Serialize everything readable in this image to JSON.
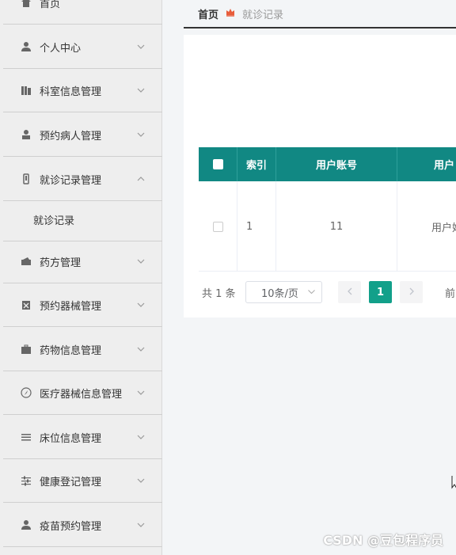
{
  "sidebar": {
    "home_label": "首页",
    "items": [
      {
        "label": "个人中心",
        "icon": "user-icon",
        "expanded": false
      },
      {
        "label": "科室信息管理",
        "icon": "building-icon",
        "expanded": false
      },
      {
        "label": "预约病人管理",
        "icon": "patient-icon",
        "expanded": false
      },
      {
        "label": "就诊记录管理",
        "icon": "phone-icon",
        "expanded": true
      },
      {
        "label": "药方管理",
        "icon": "wallet-icon",
        "expanded": false
      },
      {
        "label": "预约器械管理",
        "icon": "clipboard-icon",
        "expanded": false
      },
      {
        "label": "药物信息管理",
        "icon": "briefcase-icon",
        "expanded": false
      },
      {
        "label": "医疗器械信息管理",
        "icon": "compass-icon",
        "expanded": false
      },
      {
        "label": "床位信息管理",
        "icon": "list-icon",
        "expanded": false
      },
      {
        "label": "健康登记管理",
        "icon": "sliders-icon",
        "expanded": false
      },
      {
        "label": "疫苗预约管理",
        "icon": "person-icon",
        "expanded": false
      }
    ],
    "submenu": {
      "label": "就诊记录"
    }
  },
  "breadcrumb": {
    "home": "首页",
    "current": "就诊记录"
  },
  "table": {
    "headers": [
      "索引",
      "用户账号",
      "用户"
    ],
    "rows": [
      {
        "index": "1",
        "account": "11",
        "name": "用户姓"
      }
    ]
  },
  "pagination": {
    "total": "共 1 条",
    "page_size": "10条/页",
    "current_page": "1",
    "jump_label": "前"
  },
  "colors": {
    "header_bg": "#118883",
    "active_page": "#12a08a",
    "breadcrumb_sep": "#e85d3b"
  },
  "watermark": "CSDN @豆包程序员"
}
